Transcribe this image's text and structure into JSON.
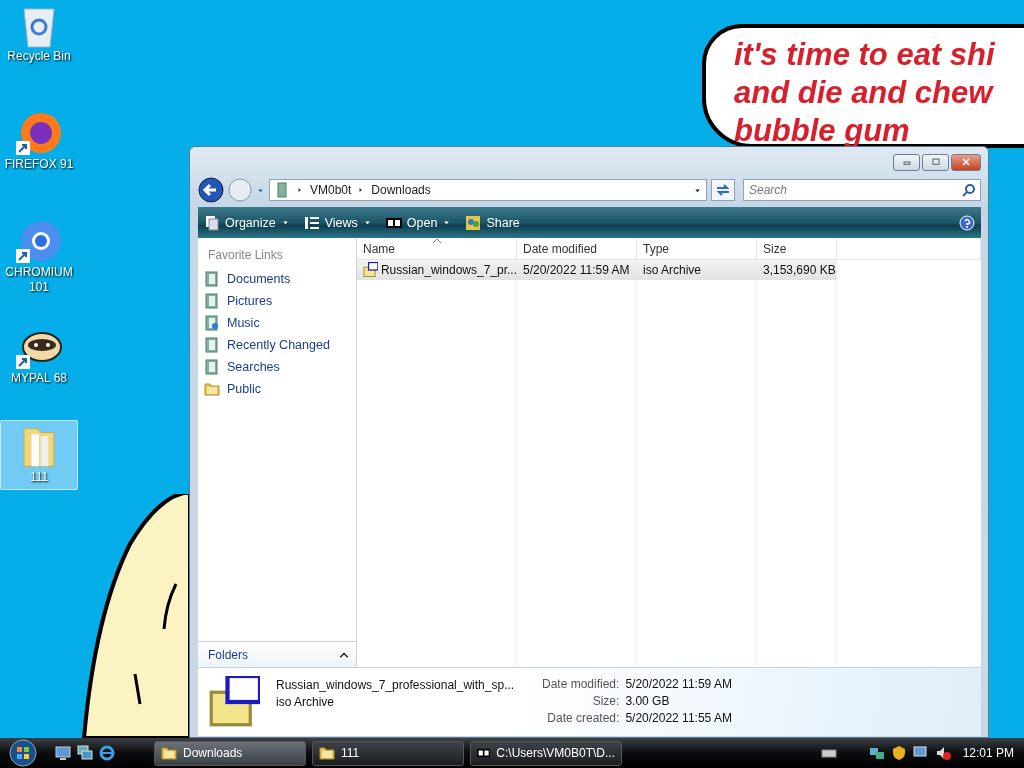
{
  "wallpaper_caption": [
    "it's time to eat shi",
    "and die and chew",
    "bubble gum"
  ],
  "desktop_icons": [
    {
      "label": "Recycle Bin",
      "kind": "bin",
      "selected": false
    },
    {
      "label": "FIREFOX 91",
      "kind": "firefox",
      "selected": false
    },
    {
      "label": "CHROMIUM 101",
      "kind": "chromium",
      "selected": false
    },
    {
      "label": "MYPAL 68",
      "kind": "raccoon",
      "selected": false
    },
    {
      "label": "111",
      "kind": "folder",
      "selected": true
    }
  ],
  "window": {
    "breadcrumb": [
      "VM0b0t",
      "Downloads"
    ],
    "search": {
      "placeholder": "Search"
    },
    "toolbar": [
      {
        "label": "Organize",
        "kind": "organize",
        "dropdown": true
      },
      {
        "label": "Views",
        "kind": "views",
        "dropdown": true
      },
      {
        "label": "Open",
        "kind": "sevenzip",
        "dropdown": true
      },
      {
        "label": "Share",
        "kind": "share",
        "dropdown": false
      }
    ],
    "sidebar": {
      "title": "Favorite Links",
      "links": [
        {
          "label": "Documents",
          "kind": "documents"
        },
        {
          "label": "Pictures",
          "kind": "pictures"
        },
        {
          "label": "Music",
          "kind": "music"
        },
        {
          "label": "Recently Changed",
          "kind": "recent"
        },
        {
          "label": "Searches",
          "kind": "searches"
        },
        {
          "label": "Public",
          "kind": "public"
        }
      ],
      "folders_label": "Folders"
    },
    "columns": [
      "Name",
      "Date modified",
      "Type",
      "Size"
    ],
    "rows": [
      {
        "cells": [
          "Russian_windows_7_pr...",
          "5/20/2022 11:59 AM",
          "iso Archive",
          "3,153,690 KB"
        ],
        "selected": true
      }
    ],
    "details": {
      "name": "Russian_windows_7_professional_with_sp...",
      "type": "iso Archive",
      "fields": [
        {
          "label": "Date modified:",
          "value": "5/20/2022 11:59 AM"
        },
        {
          "label": "Size:",
          "value": "3.00 GB"
        },
        {
          "label": "Date created:",
          "value": "5/20/2022 11:55 AM"
        }
      ]
    }
  },
  "taskbar": {
    "buttons": [
      {
        "label": "Downloads",
        "kind": "folder",
        "selected": true
      },
      {
        "label": "111",
        "kind": "folder",
        "selected": false
      },
      {
        "label": "C:\\Users\\VM0B0T\\D...",
        "kind": "sevenzip",
        "selected": false
      }
    ],
    "clock": "12:01 PM"
  }
}
